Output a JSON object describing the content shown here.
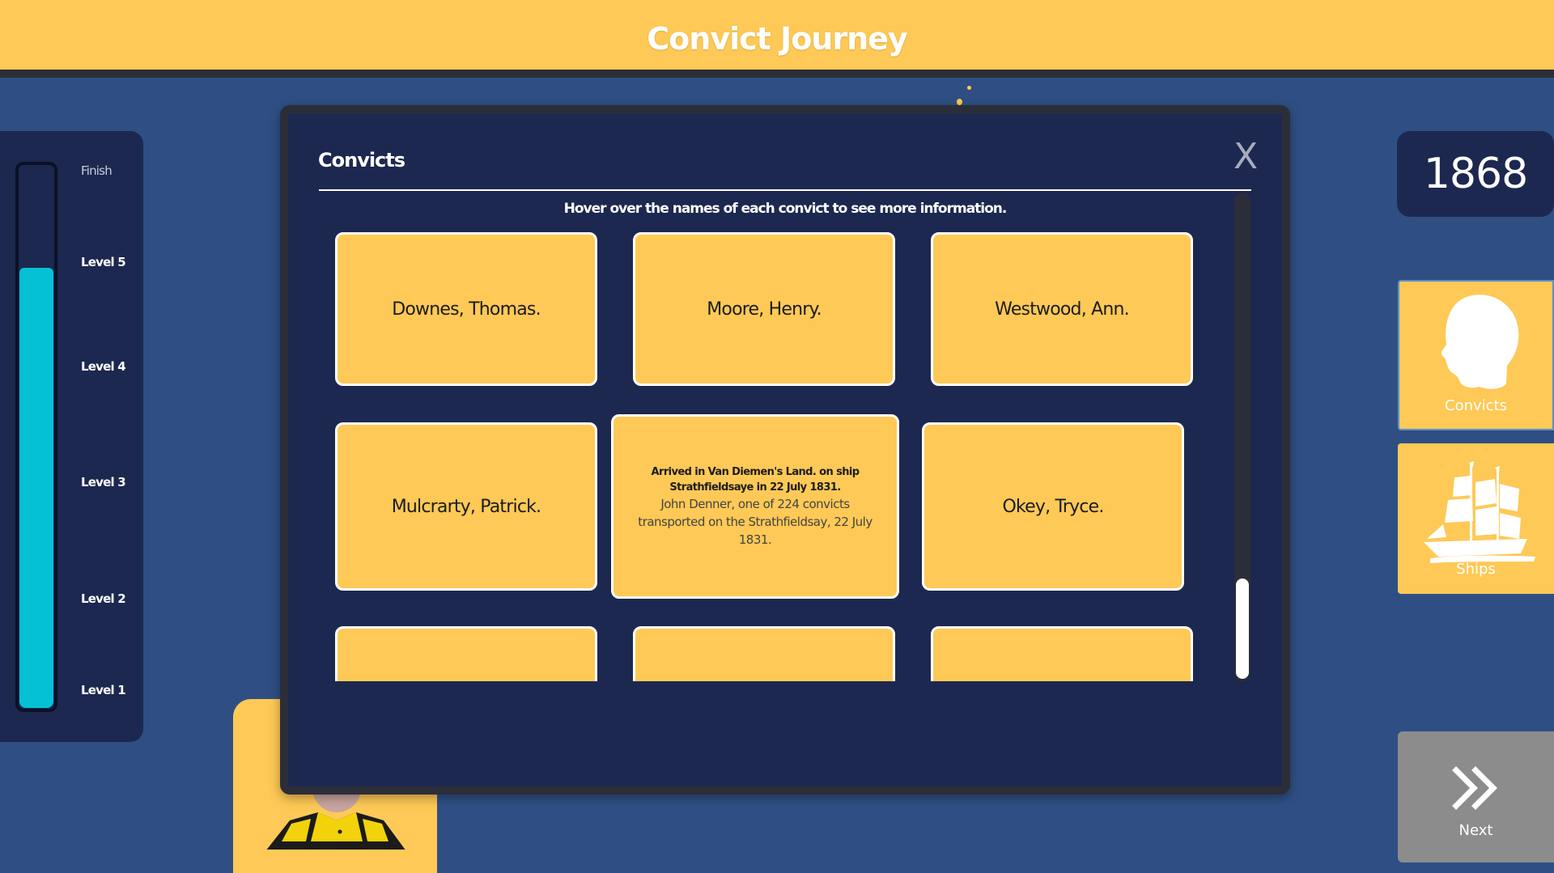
{
  "header": {
    "title": "Convict Journey"
  },
  "levels": {
    "finish_label": "Finish",
    "items": [
      "Level 5",
      "Level 4",
      "Level 3",
      "Level 2",
      "Level 1"
    ],
    "progress_fraction": 0.81,
    "fill_color": "#05c1d6"
  },
  "year": "1868",
  "side_nav": {
    "convicts_label": "Convicts",
    "ships_label": "Ships",
    "next_label": "Next"
  },
  "modal": {
    "title": "Convicts",
    "close_label": "X",
    "instruction": "Hover over the names of each convict to see more information.",
    "cards": [
      "Downes, Thomas.",
      "Moore, Henry.",
      "Westwood, Ann.",
      "Mulcrarty, Patrick.",
      "",
      "Okey, Tryce."
    ],
    "hover_card": {
      "heading": "Arrived in Van Diemen's Land. on ship Strathfieldsaye in 22 July 1831.",
      "body": "John Denner, one of 224 convicts transported on the Strathfieldsay, 22 July 1831."
    }
  },
  "colors": {
    "background": "#2f4f84",
    "panel": "#1c284f",
    "accent_yellow": "#fec956",
    "progress": "#05c1d6",
    "next_button": "#8c8c8c"
  },
  "icons": [
    "convict-head-icon",
    "ship-icon",
    "double-chevron-right-icon"
  ]
}
